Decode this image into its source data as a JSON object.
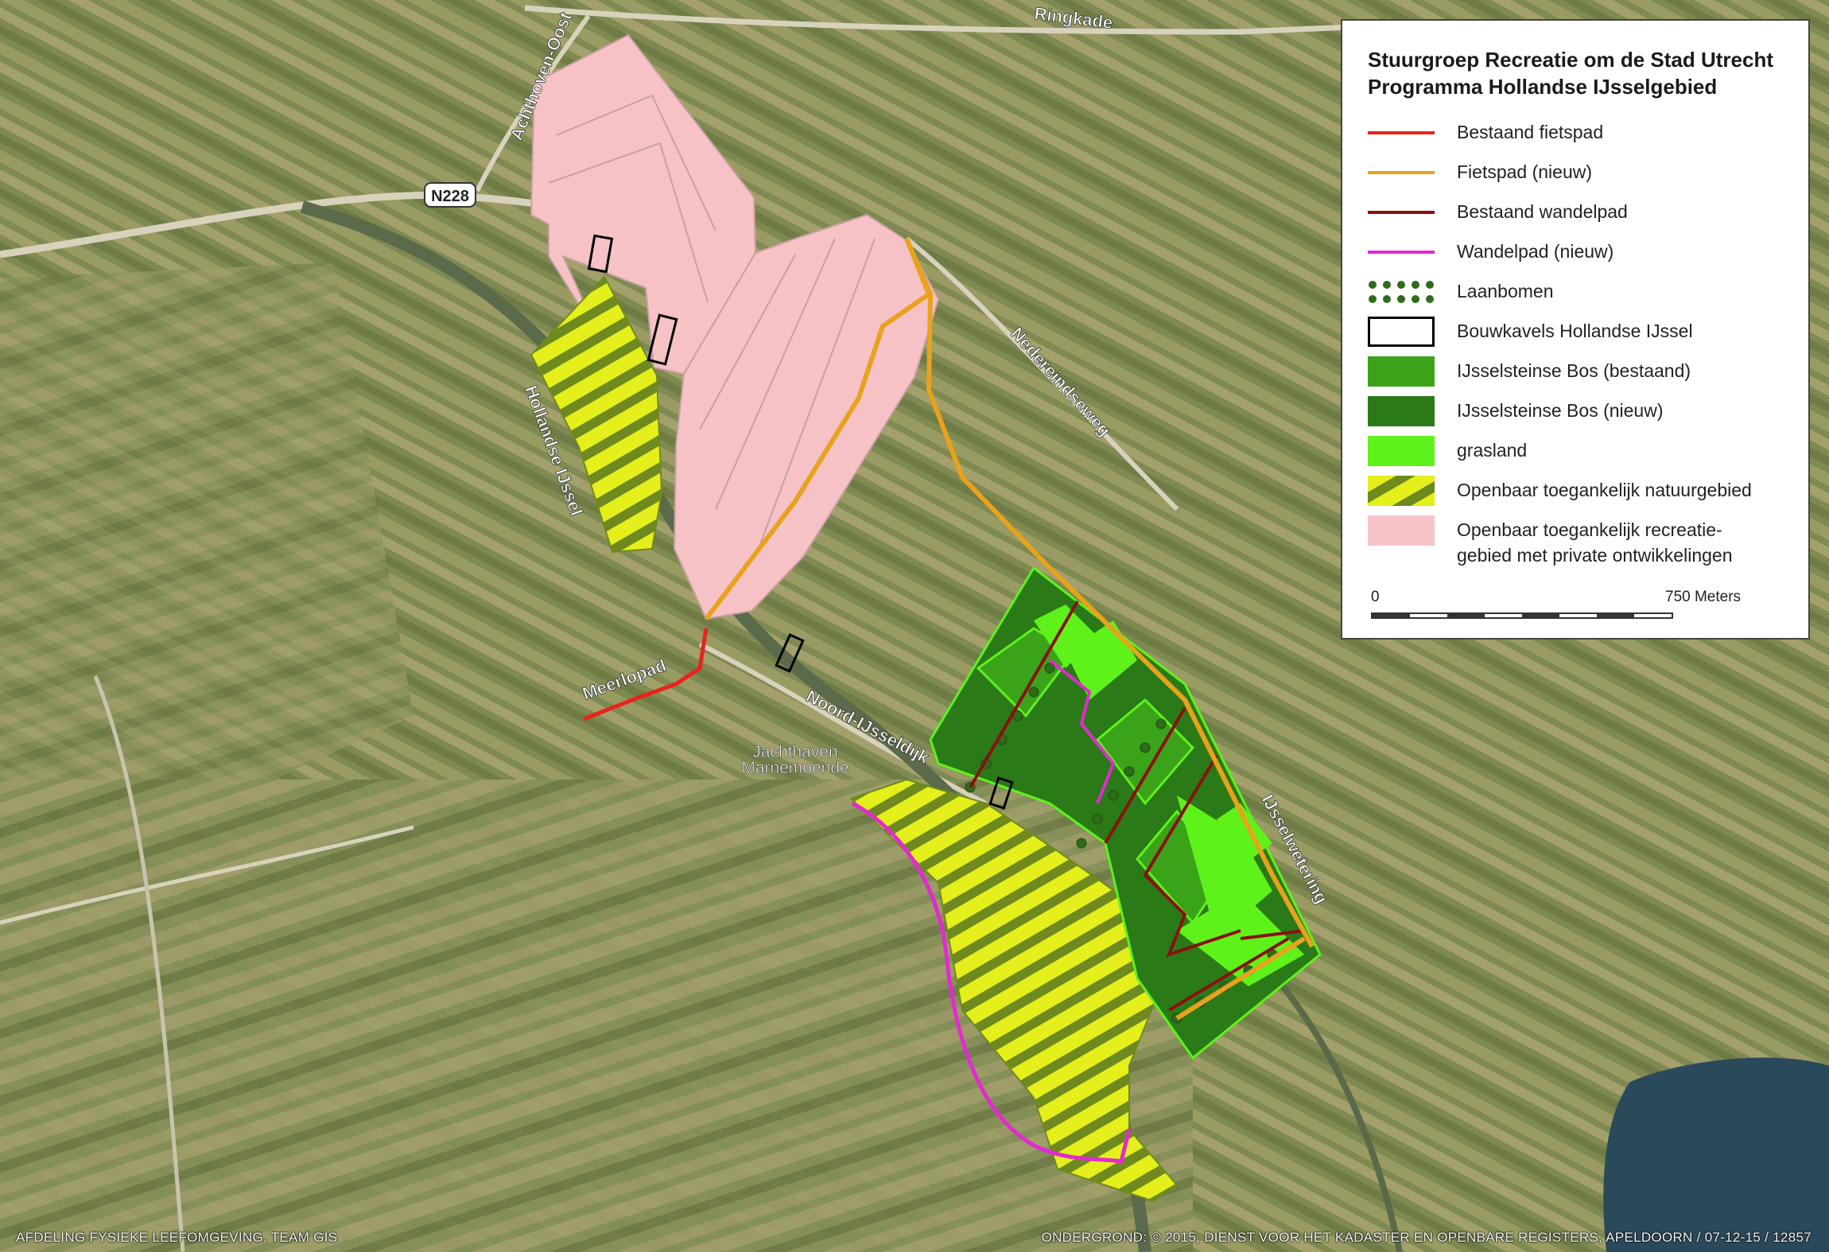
{
  "legend": {
    "title_line1": "Stuurgroep Recreatie om de Stad Utrecht",
    "title_line2": "Programma Hollandse IJsselgebied",
    "items": [
      {
        "label": "Bestaand fietspad",
        "color": "#e8231b"
      },
      {
        "label": "Fietspad (nieuw)",
        "color": "#e8a21c"
      },
      {
        "label": "Bestaand wandelpad",
        "color": "#8a1010"
      },
      {
        "label": "Wandelpad (nieuw)",
        "color": "#e22ad0"
      },
      {
        "label": "Laanbomen",
        "color": "#2e6b1a"
      },
      {
        "label": "Bouwkavels Hollandse IJssel",
        "color": "#000000"
      },
      {
        "label": "IJsselsteinse Bos (bestaand)",
        "color": "#3aa31a"
      },
      {
        "label": "IJsselsteinse Bos (nieuw)",
        "color": "#2a7a18"
      },
      {
        "label": "grasland",
        "color": "#5ff21a"
      },
      {
        "label": "Openbaar toegankelijk natuurgebied",
        "color": "#e8f21a"
      },
      {
        "label_line1": "Openbaar toegankelijk recreatie-",
        "label_line2": "gebied met private ontwikkelingen",
        "color": "#f7c5c8"
      }
    ],
    "scale": {
      "start": "0",
      "end": "750 Meters"
    }
  },
  "map_labels": {
    "ringkade": "Ringkade",
    "achthoven": "Achthoven-Oost",
    "n228": "N228",
    "hollandse_ijssel": "Hollandse IJssel",
    "nedereindseweg": "Nedereindseweg",
    "meerlopad": "Meerlopad",
    "noord_ijsseldijk": "Noord-IJsseldijk",
    "jachthaven1": "Jachthaven",
    "jachthaven2": "Marnemoende",
    "ijsselwetering": "IJsselwetering"
  },
  "footer": {
    "left": "AFDELING FYSIEKE LEEFOMGEVING, TEAM GIS",
    "right": "ONDERGROND: © 2015, DIENST VOOR HET KADASTER EN OPENBARE REGISTERS, APELDOORN / 07-12-15 / 12857"
  }
}
